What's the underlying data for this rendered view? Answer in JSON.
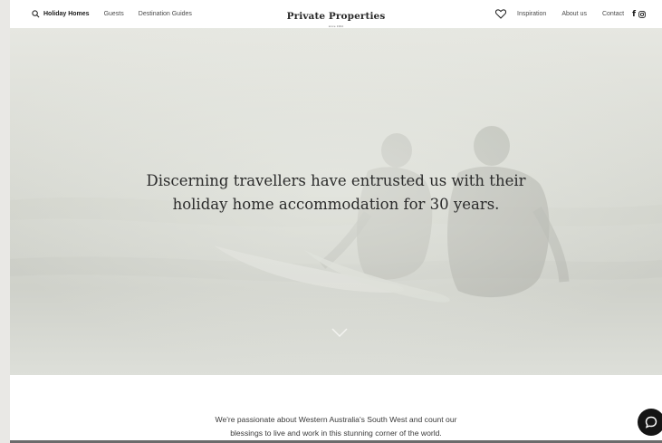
{
  "nav": {
    "left": [
      {
        "label": "Holiday Homes",
        "icon": "search-icon"
      },
      {
        "label": "Guests"
      },
      {
        "label": "Destination Guides"
      }
    ],
    "brand": {
      "name": "Private Properties",
      "tagline": "since 1994"
    },
    "right": [
      {
        "label": "Inspiration"
      },
      {
        "label": "About us"
      },
      {
        "label": "Contact"
      }
    ],
    "icons": [
      "heart-icon",
      "facebook-icon",
      "instagram-icon"
    ]
  },
  "hero": {
    "heading_line1": "Discerning travellers have entrusted us with their",
    "heading_line2": "holiday home accommodation for 30 years.",
    "scroll_icon": "chevron-down-icon"
  },
  "intro": {
    "line1": "We're passionate about Western Australia's South West and count our",
    "line2": "blessings to live and work in this stunning corner of the world."
  },
  "chat": {
    "icon": "chat-icon"
  },
  "colors": {
    "hero_tint": "#d9dbd5",
    "text_dark": "#2b2b2b",
    "chat_bg": "#151515"
  }
}
